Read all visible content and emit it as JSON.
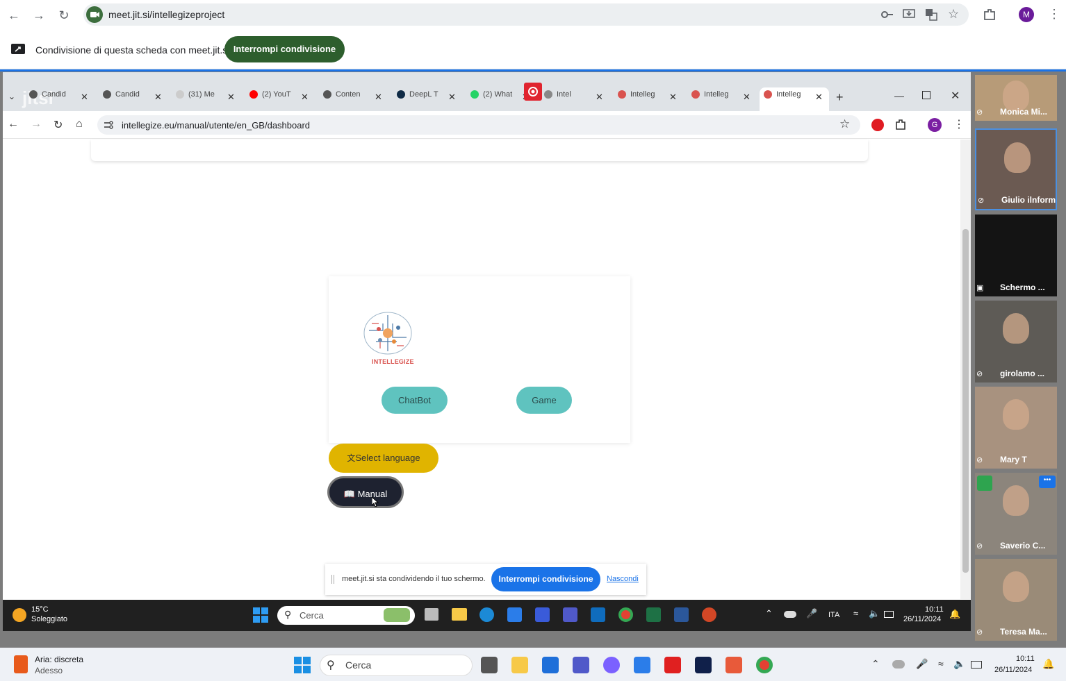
{
  "outer_browser": {
    "url": "meet.jit.si/intellegizeproject",
    "profile_initial": "M"
  },
  "share_banner": {
    "text": "Condivisione di questa scheda con meet.jit.si",
    "stop_button": "Interrompi condivisione"
  },
  "inner_browser": {
    "tabs": [
      {
        "label": "Candid",
        "color": "#555555"
      },
      {
        "label": "Candid",
        "color": "#555555"
      },
      {
        "label": "(31) Me",
        "color": "#cccccc"
      },
      {
        "label": "(2) YouT",
        "color": "#ff0000"
      },
      {
        "label": "Conten",
        "color": "#555555"
      },
      {
        "label": "DeepL T",
        "color": "#0f2b46"
      },
      {
        "label": "(2) What",
        "color": "#25d366"
      },
      {
        "label": "Intel",
        "color": "#888888"
      },
      {
        "label": "Intelleg",
        "color": "#d9534f"
      },
      {
        "label": "Intelleg",
        "color": "#d9534f"
      },
      {
        "label": "Intelleg",
        "color": "#d9534f"
      }
    ],
    "url": "intellegize.eu/manual/utente/en_GB/dashboard",
    "profile_initial": "G",
    "jitsi_watermark": "jitsi"
  },
  "app": {
    "logo_text": "INTELLEGIZE",
    "chatbot_label": "ChatBot",
    "game_label": "Game",
    "select_language_label": "Select language",
    "manual_label": "Manual"
  },
  "share_popup": {
    "text": "meet.jit.si sta condividendo il tuo schermo.",
    "stop_label": "Interrompi condivisione",
    "hide_label": "Nascondi"
  },
  "inner_taskbar": {
    "weather_temp": "15°C",
    "weather_desc": "Soleggiato",
    "search_placeholder": "Cerca",
    "lang": "ITA",
    "time": "10:11",
    "date": "26/11/2024"
  },
  "participants": [
    {
      "name": "Monica Mi...",
      "bg": "#b79b78"
    },
    {
      "name": "Giulio ilnform...",
      "bg": "#6b5a52"
    },
    {
      "name": "Schermo ...",
      "bg": "#141414"
    },
    {
      "name": "girolamo ...",
      "bg": "#5e5b56"
    },
    {
      "name": "Mary T",
      "bg": "#a8927f"
    },
    {
      "name": "Saverio C...",
      "bg": "#8c857c"
    },
    {
      "name": "Teresa Ma...",
      "bg": "#9a8b78"
    }
  ],
  "outer_taskbar": {
    "weather_title": "Aria: discreta",
    "weather_sub": "Adesso",
    "search_placeholder": "Cerca",
    "time": "10:11",
    "date": "26/11/2024"
  },
  "colors": {
    "share_green": "#2d5e2d",
    "teal": "#5fc3bf",
    "gold": "#e0b400",
    "dark": "#1e2230",
    "blue": "#1a73e8"
  }
}
